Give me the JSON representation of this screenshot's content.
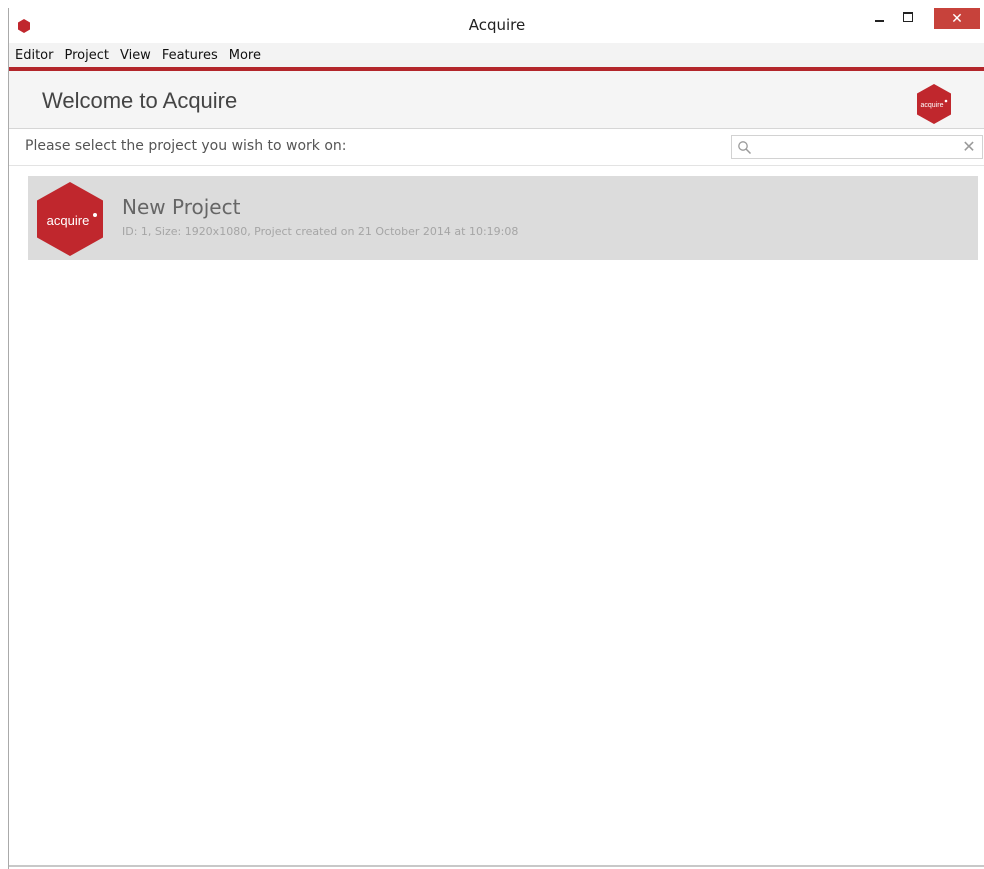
{
  "window": {
    "title": "Acquire",
    "accent_color": "#b3262b",
    "close_symbol": "✕"
  },
  "menu": {
    "items": [
      {
        "label": "Editor"
      },
      {
        "label": "Project"
      },
      {
        "label": "View"
      },
      {
        "label": "Features"
      },
      {
        "label": "More"
      }
    ]
  },
  "header": {
    "title": "Welcome to Acquire",
    "logo_icon": "acquire-logo"
  },
  "instruction": {
    "text": "Please select the project you wish to work on:"
  },
  "search": {
    "value": "",
    "placeholder": "",
    "icon": "search-icon",
    "clear_symbol": "✕"
  },
  "projects": [
    {
      "name": "New Project",
      "meta": "ID: 1, Size: 1920x1080, Project created on 21 October 2014 at 10:19:08",
      "logo_text": "acquire",
      "logo_color": "#c0272d"
    }
  ]
}
